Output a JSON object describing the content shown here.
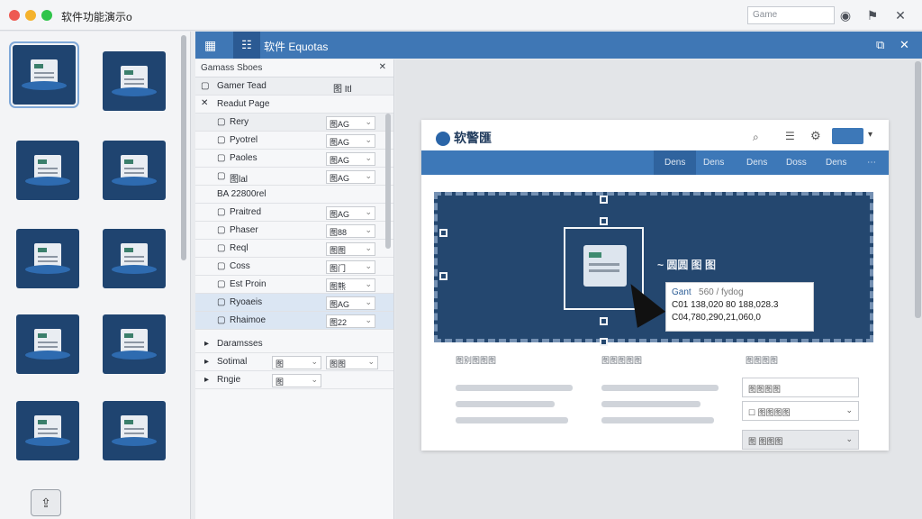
{
  "window": {
    "title": "软件功能演示o",
    "search_placeholder": "Game"
  },
  "toolbar_icons": [
    "info-icon",
    "flag-icon",
    "close-icon"
  ],
  "thumbnails_count": 10,
  "header": {
    "grid_icon": "▦",
    "panel_icon": "☷",
    "title": "软件 Equotas",
    "right_icons": [
      "⧉",
      "✕"
    ]
  },
  "props": {
    "title": "Gamass Sboes",
    "row_gamer_tead": {
      "label": "Gamer Tead",
      "value": "图 Itl"
    },
    "row_readut": {
      "label": "Readut Page"
    },
    "rows": [
      {
        "label": "Rery",
        "value": "图AG"
      },
      {
        "label": "Pyotrel",
        "value": "图AG"
      },
      {
        "label": "Paoles",
        "value": "图AG"
      },
      {
        "label": "图lal",
        "value": "图AG"
      }
    ],
    "section": "BA 22800rel",
    "rows2": [
      {
        "label": "Praitred",
        "value": "图AG"
      },
      {
        "label": "Phaser",
        "value": "图88"
      },
      {
        "label": "Reql",
        "value": "图图"
      },
      {
        "label": "Coss",
        "value": "图门"
      },
      {
        "label": "Est Proin",
        "value": "图熊"
      },
      {
        "label": "Ryoaeis",
        "value": "图AG"
      },
      {
        "label": "Rhaimoe",
        "value": "图22"
      }
    ],
    "groups": [
      {
        "label": "Daramsses"
      },
      {
        "label": "Sotimal",
        "value_a": "图",
        "value_b": "图图"
      },
      {
        "label": "Rngie",
        "value_a": "图"
      }
    ]
  },
  "page": {
    "logo": "软警匯",
    "nav": [
      "Dens",
      "Dens",
      "Dens",
      "Doss",
      "Dens"
    ],
    "hero_text": "~ 圆圆 图 图",
    "tooltip": {
      "title": "Gant",
      "title_suffix": "560 / fydog",
      "line1": "C01 138,020 80 188,028.3",
      "line2": "C04,780,290,21,060,0"
    },
    "col_heads": [
      "图别图图图",
      "图图图图图",
      "图图图图"
    ],
    "right_fields": [
      "图图图图",
      "图图图图",
      "图 图图图"
    ]
  }
}
